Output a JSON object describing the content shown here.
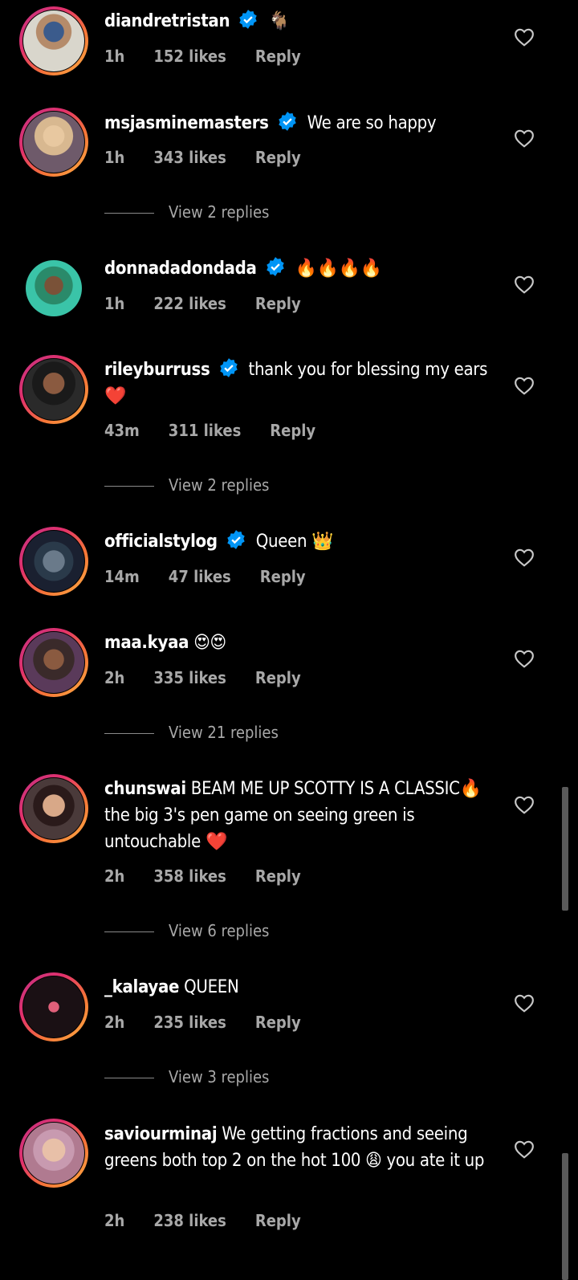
{
  "comments": [
    {
      "username": "diandretristan",
      "text": "🐐",
      "time": "1h",
      "likes": "152 likes",
      "reply": "Reply"
    },
    {
      "username": "msjasminemasters",
      "text": "We are so happy",
      "time": "1h",
      "likes": "343 likes",
      "reply": "Reply",
      "view_replies": "View 2 replies"
    },
    {
      "username": "donnadadondada",
      "text": "🔥🔥🔥🔥",
      "time": "1h",
      "likes": "222 likes",
      "reply": "Reply"
    },
    {
      "username": "rileyburruss",
      "text": "thank you for blessing my ears ❤️",
      "time": "43m",
      "likes": "311 likes",
      "reply": "Reply",
      "view_replies": "View 2 replies"
    },
    {
      "username": "officialstylog",
      "text": "Queen 👑",
      "time": "14m",
      "likes": "47 likes",
      "reply": "Reply"
    },
    {
      "username": "maa.kyaa",
      "text": "😍😍",
      "time": "2h",
      "likes": "335 likes",
      "reply": "Reply",
      "view_replies": "View 21 replies"
    },
    {
      "username": "chunswai",
      "text": "BEAM ME UP SCOTTY IS A CLASSIC🔥 the big 3's pen game on seeing green is untouchable ❤️",
      "time": "2h",
      "likes": "358 likes",
      "reply": "Reply",
      "view_replies": "View 6 replies"
    },
    {
      "username": "_kalayae",
      "text": "QUEEN",
      "time": "2h",
      "likes": "235 likes",
      "reply": "Reply",
      "view_replies": "View 3 replies"
    },
    {
      "username": "saviourminaj",
      "text": "We getting fractions and seeing greens both top 2 on the hot 100 😩 you ate it up",
      "time": "2h",
      "likes": "238 likes",
      "reply": "Reply"
    }
  ],
  "icons": {
    "like": "heart-outline-icon",
    "verified": "verified-badge-icon"
  },
  "colors": {
    "background": "#000000",
    "verified": "#0095f6",
    "meta": "#a8a8a8"
  }
}
